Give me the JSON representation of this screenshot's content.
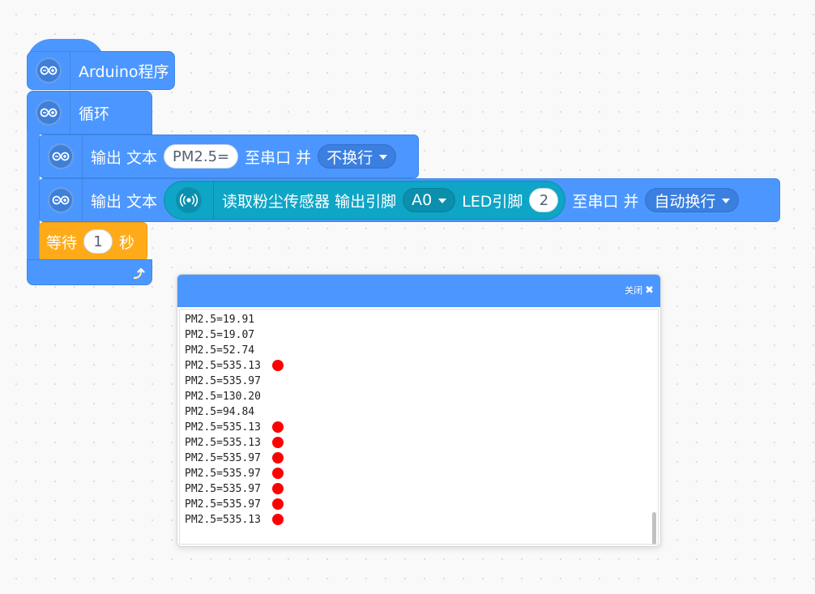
{
  "blocks": {
    "hat": {
      "label": "Arduino程序",
      "icon": "arduino-icon"
    },
    "loop": {
      "label": "循环",
      "icon": "arduino-icon"
    },
    "print_text": {
      "label": "输出 文本",
      "value": "PM2.5=",
      "suffix": "至串口 并",
      "newline_option": "不换行"
    },
    "print_sensor": {
      "label": "输出 文本",
      "sensor_icon": "sensor-wave-icon",
      "sensor_label": "读取粉尘传感器 输出引脚",
      "pin": "A0",
      "led_label": "LED引脚",
      "led_pin": "2",
      "suffix": "至串口 并",
      "newline_option": "自动换行"
    },
    "wait": {
      "label": "等待",
      "value": "1",
      "unit": "秒"
    }
  },
  "monitor": {
    "close_label": "关闭",
    "close_icon": "close-icon",
    "lines": [
      {
        "text": "PM2.5=19.91",
        "marked": false
      },
      {
        "text": "PM2.5=19.07",
        "marked": false
      },
      {
        "text": "PM2.5=52.74",
        "marked": false
      },
      {
        "text": "PM2.5=535.13",
        "marked": true
      },
      {
        "text": "PM2.5=535.97",
        "marked": false
      },
      {
        "text": "PM2.5=130.20",
        "marked": false
      },
      {
        "text": "PM2.5=94.84",
        "marked": false
      },
      {
        "text": "PM2.5=535.13",
        "marked": true
      },
      {
        "text": "PM2.5=535.13",
        "marked": true
      },
      {
        "text": "PM2.5=535.97",
        "marked": true
      },
      {
        "text": "PM2.5=535.97",
        "marked": true
      },
      {
        "text": "PM2.5=535.97",
        "marked": true
      },
      {
        "text": "PM2.5=535.97",
        "marked": true
      },
      {
        "text": "PM2.5=535.13",
        "marked": true
      }
    ],
    "mark_color": "#ff0000"
  },
  "colors": {
    "motion_blue": "#4c97ff",
    "sensor_teal": "#0ea5c6",
    "control_orange": "#ffab19"
  }
}
